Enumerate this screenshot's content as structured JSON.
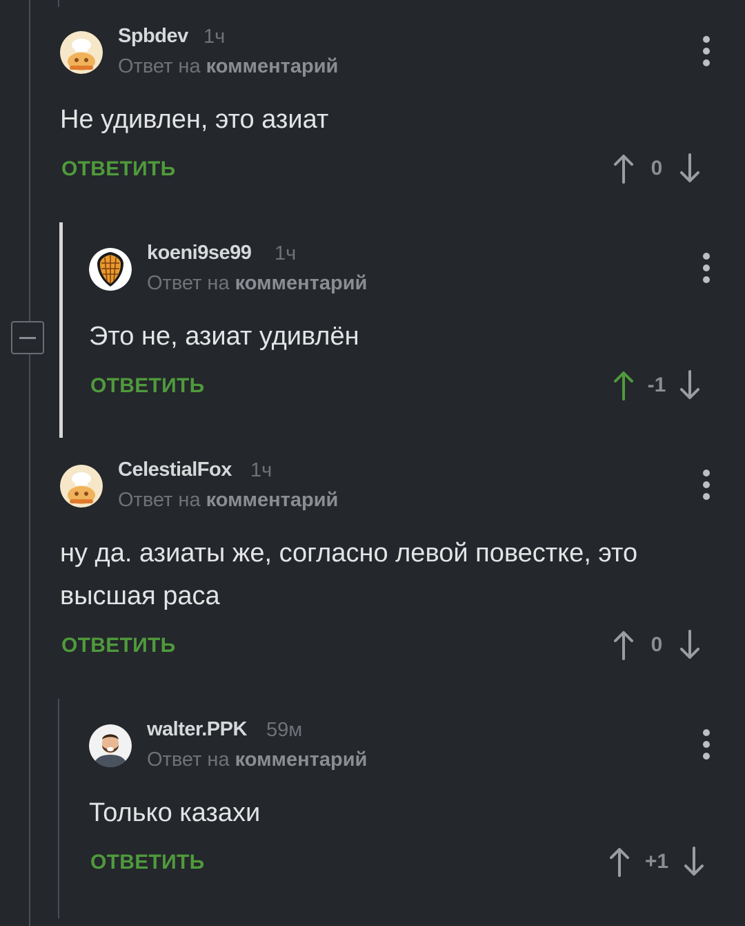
{
  "collapse_label": "−",
  "comments": [
    {
      "username": "Spbdev",
      "time": "1ч",
      "reply_prefix": "Ответ на",
      "reply_target": "комментарий",
      "text": "Не удивлен, это азиат",
      "reply_label": "ОТВЕТИТЬ",
      "score": "0",
      "upvoted": false
    },
    {
      "username": "koeni9se99",
      "time": "1ч",
      "reply_prefix": "Ответ на",
      "reply_target": "комментарий",
      "text": "Это не, азиат удивлён",
      "reply_label": "ОТВЕТИТЬ",
      "score": "-1",
      "upvoted": true
    },
    {
      "username": "CelestialFox",
      "time": "1ч",
      "reply_prefix": "Ответ на",
      "reply_target": "комментарий",
      "text": "ну да. азиаты же, согласно левой повестке, это высшая раса",
      "reply_label": "ОТВЕТИТЬ",
      "score": "0",
      "upvoted": false
    },
    {
      "username": "walter.PPK",
      "time": "59м",
      "reply_prefix": "Ответ на",
      "reply_target": "комментарий",
      "text": "Только казахи",
      "reply_label": "ОТВЕТИТЬ",
      "score": "+1",
      "upvoted": false
    }
  ],
  "colors": {
    "background": "#24272b",
    "accent_green": "#4f9a3c",
    "text": "#e3e4e5",
    "muted": "#6f7378"
  }
}
